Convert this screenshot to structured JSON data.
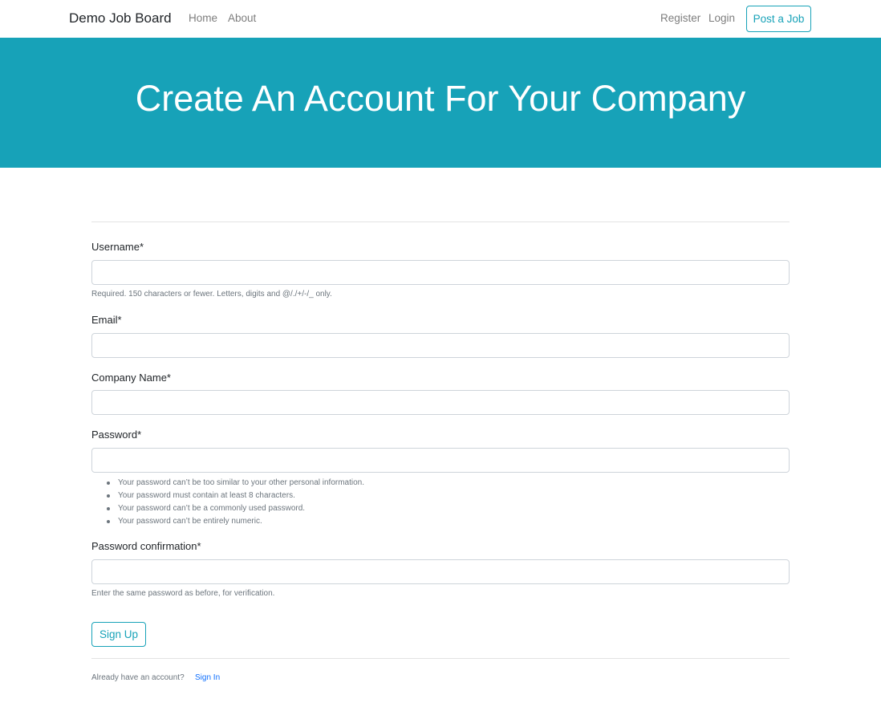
{
  "navbar": {
    "brand": "Demo Job Board",
    "links": {
      "home": "Home",
      "about": "About",
      "register": "Register",
      "login": "Login"
    },
    "post_job_label": "Post a Job"
  },
  "hero": {
    "title": "Create An Account For Your Company"
  },
  "form": {
    "username": {
      "label": "Username*",
      "value": "",
      "help": "Required. 150 characters or fewer. Letters, digits and @/./+/-/_ only."
    },
    "email": {
      "label": "Email*",
      "value": ""
    },
    "company_name": {
      "label": "Company Name*",
      "value": ""
    },
    "password": {
      "label": "Password*",
      "value": "",
      "rules": [
        "Your password can’t be too similar to your other personal information.",
        "Your password must contain at least 8 characters.",
        "Your password can’t be a commonly used password.",
        "Your password can’t be entirely numeric."
      ]
    },
    "password_confirmation": {
      "label": "Password confirmation*",
      "value": "",
      "help": "Enter the same password as before, for verification."
    },
    "submit_label": "Sign Up"
  },
  "footer": {
    "prompt": "Already have an account?",
    "signin_label": "Sign In"
  },
  "colors": {
    "accent": "#17a2b8",
    "link": "#0d6efd"
  }
}
